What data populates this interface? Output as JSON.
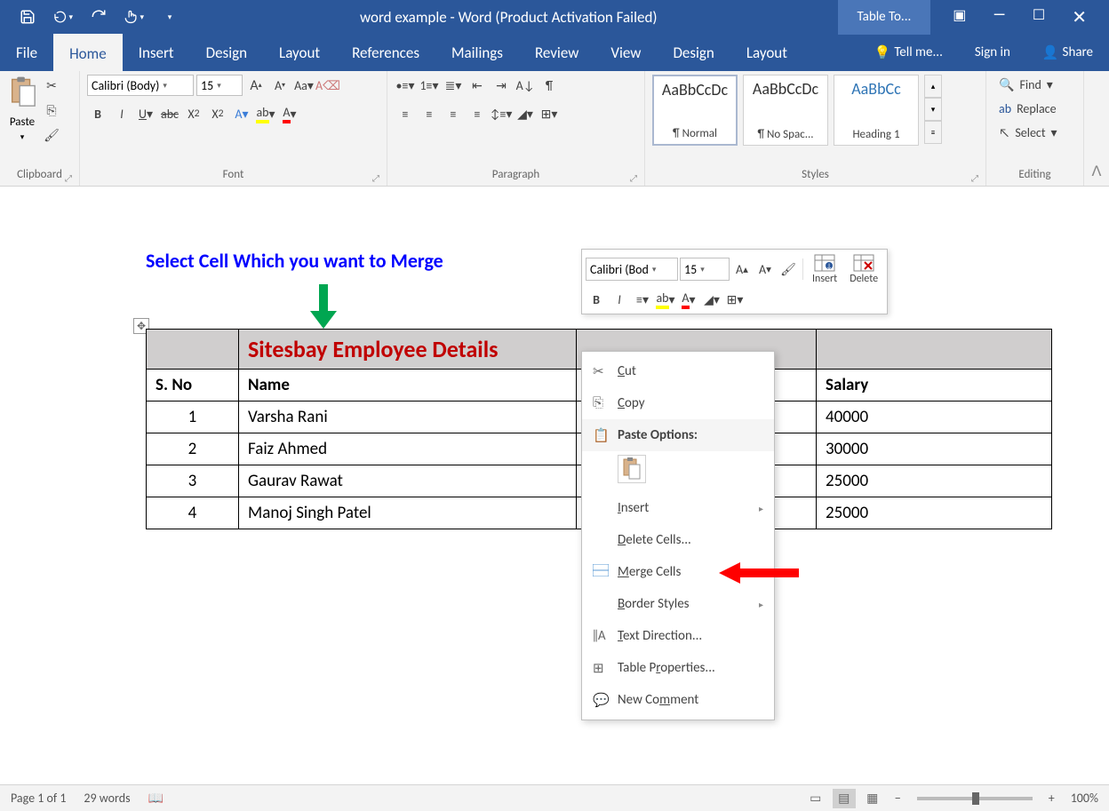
{
  "titlebar": {
    "title": "word example - Word  (Product Activation Failed)",
    "context_tab": "Table To..."
  },
  "tabs": {
    "file": "File",
    "home": "Home",
    "insert": "Insert",
    "design": "Design",
    "layout": "Layout",
    "references": "References",
    "mailings": "Mailings",
    "review": "Review",
    "view": "View",
    "design2": "Design",
    "layout2": "Layout",
    "tellme": "Tell me...",
    "signin": "Sign in",
    "share": "Share"
  },
  "ribbon": {
    "clipboard": {
      "label": "Clipboard",
      "paste": "Paste"
    },
    "font": {
      "label": "Font",
      "name": "Calibri (Body)",
      "size": "15"
    },
    "paragraph": {
      "label": "Paragraph"
    },
    "styles": {
      "label": "Styles",
      "items": [
        {
          "preview": "AaBbCcDc",
          "name": "¶ Normal"
        },
        {
          "preview": "AaBbCcDc",
          "name": "¶ No Spac..."
        },
        {
          "preview": "AaBbCc",
          "name": "Heading 1"
        }
      ]
    },
    "editing": {
      "label": "Editing",
      "find": "Find",
      "replace": "Replace",
      "select": "Select"
    }
  },
  "annotation": {
    "text": "Select Cell Which you want to Merge"
  },
  "table": {
    "title": "Sitesbay Employee Details",
    "headers": {
      "sno": "S. No",
      "name": "Name",
      "salary": "Salary"
    },
    "rows": [
      {
        "sno": "1",
        "name": "Varsha Rani",
        "salary": "40000"
      },
      {
        "sno": "2",
        "name": "Faiz Ahmed",
        "salary": "30000"
      },
      {
        "sno": "3",
        "name": "Gaurav Rawat",
        "salary": "25000"
      },
      {
        "sno": "4",
        "name": "Manoj Singh Patel",
        "salary": "25000"
      }
    ]
  },
  "mini": {
    "font": "Calibri (Bod",
    "size": "15",
    "insert": "Insert",
    "delete": "Delete"
  },
  "ctx": {
    "cut": "Cut",
    "copy": "Copy",
    "paste_header": "Paste Options:",
    "insert": "Insert",
    "delete": "Delete Cells...",
    "merge": "Merge Cells",
    "border": "Border Styles",
    "textdir": "Text Direction...",
    "props": "Table Properties...",
    "comment": "New Comment"
  },
  "status": {
    "page": "Page 1 of 1",
    "words": "29 words",
    "zoom": "100%"
  }
}
